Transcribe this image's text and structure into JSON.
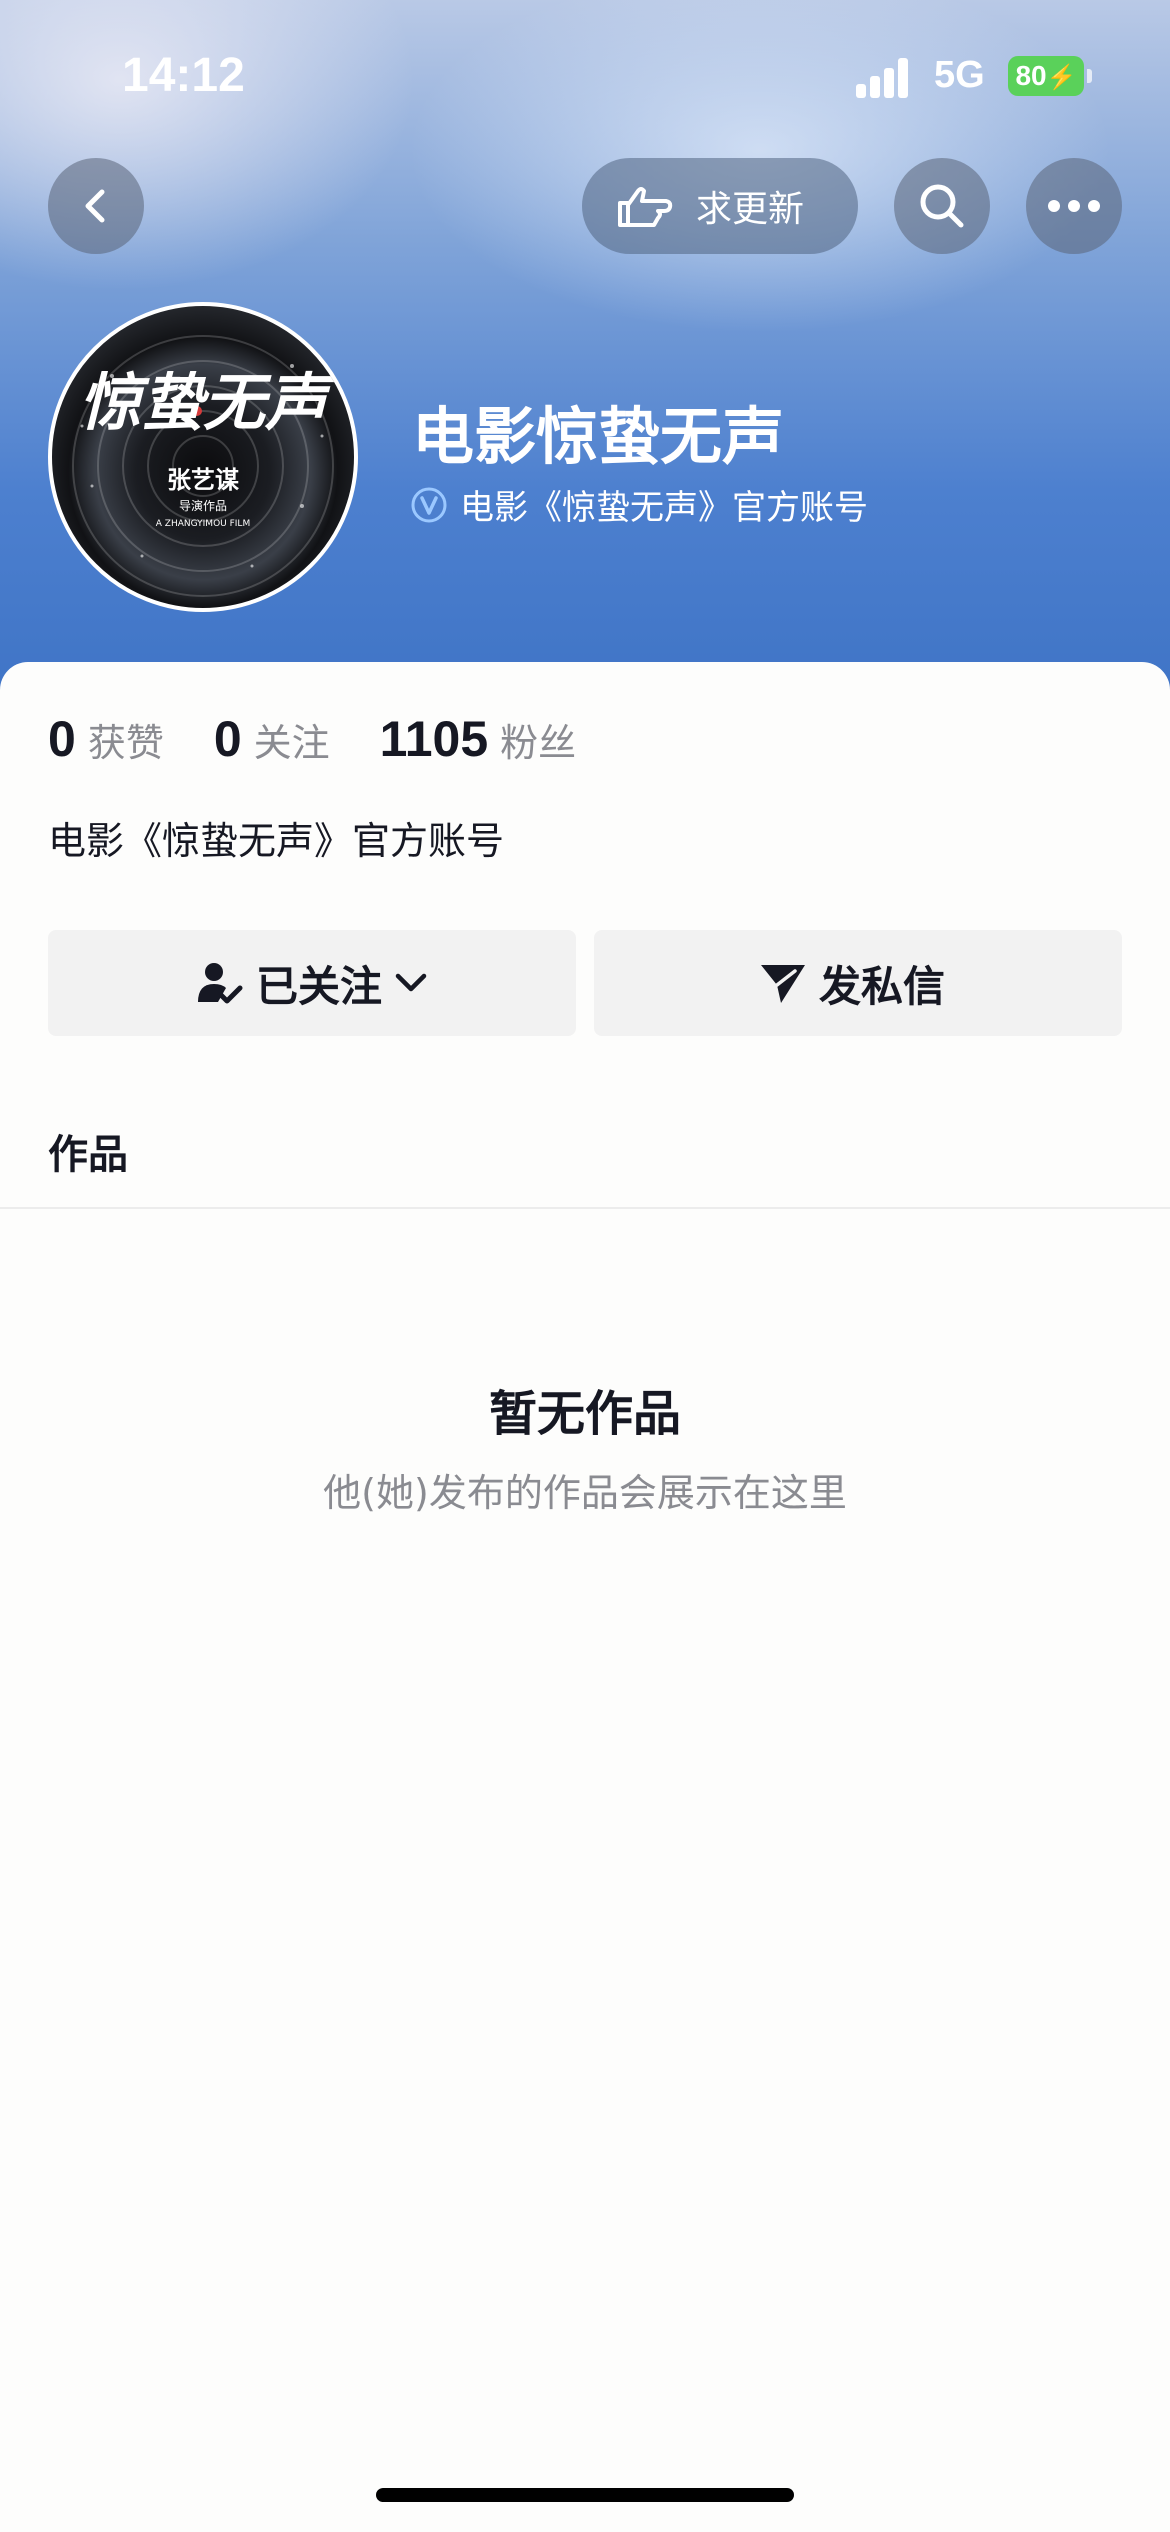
{
  "status_bar": {
    "time": "14:12",
    "network": "5G",
    "battery": "80"
  },
  "header": {
    "request_update_label": "求更新",
    "icons": {
      "back": "chevron-left-icon",
      "request": "pointing-hand-icon",
      "search": "search-icon",
      "more": "more-dots-icon"
    }
  },
  "profile": {
    "name": "电影惊蛰无声",
    "verification": "电影《惊蛰无声》官方账号",
    "avatar": {
      "title": "惊蛰无声",
      "director": "张艺谋",
      "subtitle": "导演作品",
      "english": "A ZHANGYIMOU FILM"
    }
  },
  "stats": [
    {
      "num": "0",
      "label": "获赞"
    },
    {
      "num": "0",
      "label": "关注"
    },
    {
      "num": "1105",
      "label": "粉丝"
    }
  ],
  "bio": "电影《惊蛰无声》官方账号",
  "actions": {
    "follow_label": "已关注",
    "message_label": "发私信"
  },
  "tabs": {
    "works": "作品"
  },
  "empty_state": {
    "title": "暂无作品",
    "description": "他(她)发布的作品会展示在这里"
  },
  "colors": {
    "header_blue": "#4d80cf",
    "battery_green": "#5ad15a",
    "muted_text": "#8a8b91"
  }
}
